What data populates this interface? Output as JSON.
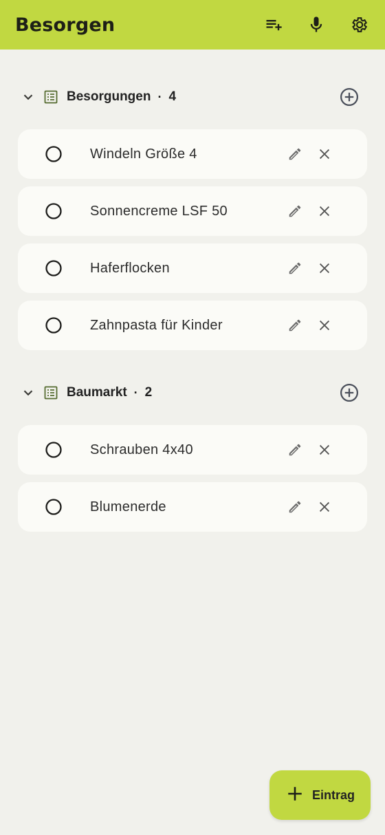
{
  "appbar": {
    "title": "Besorgen",
    "icons": [
      "add-list-icon",
      "mic-icon",
      "gear-icon"
    ]
  },
  "sections": [
    {
      "name": "Besorgungen",
      "separator": "·",
      "count": "4",
      "items": [
        {
          "label": "Windeln Größe 4"
        },
        {
          "label": "Sonnencreme LSF 50"
        },
        {
          "label": "Haferflocken"
        },
        {
          "label": "Zahnpasta für Kinder"
        }
      ]
    },
    {
      "name": "Baumarkt",
      "separator": "·",
      "count": "2",
      "items": [
        {
          "label": "Schrauben 4x40"
        },
        {
          "label": "Blumenerde"
        }
      ]
    }
  ],
  "fab": {
    "label": "Eintrag",
    "icon": "plus-icon"
  },
  "colors": {
    "accent": "#c1d841",
    "background": "#f1f1ec",
    "card": "#fbfbf7",
    "list_icon": "#556b2f"
  }
}
